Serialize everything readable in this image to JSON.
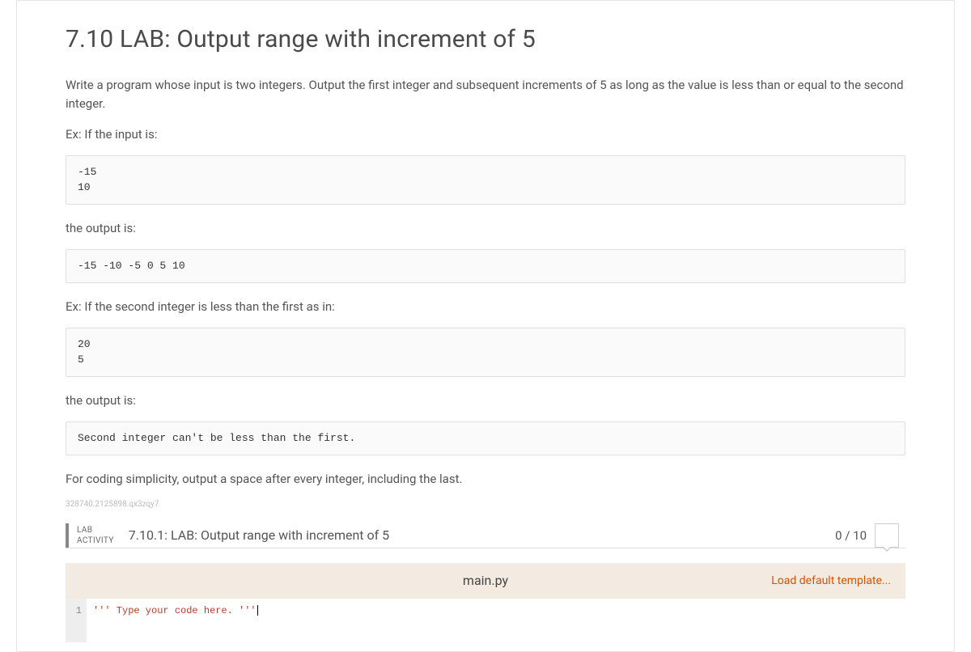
{
  "title": "7.10 LAB: Output range with increment of 5",
  "para1": "Write a program whose input is two integers. Output the first integer and subsequent increments of 5 as long as the value is less than or equal to the second integer.",
  "ex_if_input": "Ex: If the input is:",
  "example1_input": "-15\n10",
  "the_output_is": "the output is:",
  "example1_output": "-15 -10 -5 0 5 10",
  "ex_second_less": "Ex: If the second integer is less than the first as in:",
  "example2_input": "20\n5",
  "example2_output": "Second integer can't be less than the first.",
  "closing_note": "For coding simplicity, output a space after every integer, including the last.",
  "seed": "328740.2125898.qx3zqy7",
  "activity": {
    "tag_line1": "LAB",
    "tag_line2": "ACTIVITY",
    "title": "7.10.1: LAB: Output range with increment of 5",
    "score": "0 / 10"
  },
  "editor": {
    "filename": "main.py",
    "load_template": "Load default template...",
    "line_number": "1",
    "code_line": "''' Type your code here. '''"
  }
}
